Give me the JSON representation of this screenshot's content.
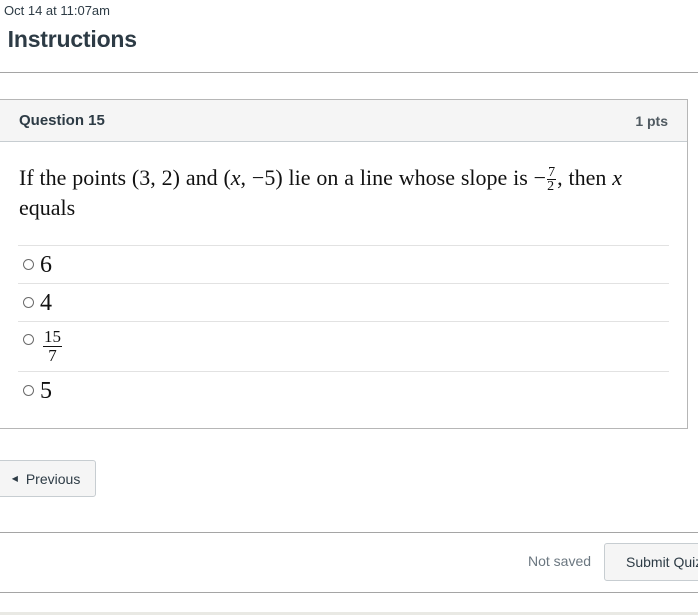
{
  "header": {
    "timestamp": "Oct 14 at 11:07am",
    "title": ": Instructions"
  },
  "question": {
    "name": "Question 15",
    "points": "1 pts",
    "text_part1": "If the points (3, 2) and (",
    "var_x": "x",
    "text_part2": ", −5) lie on a line whose slope is −",
    "slope_numerator": "7",
    "slope_denominator": "2",
    "text_part3": ", then ",
    "text_part4": " equals",
    "answers": [
      {
        "label": "6",
        "selected": false
      },
      {
        "label": "4",
        "selected": false
      },
      {
        "numerator": "15",
        "denominator": "7",
        "selected": false
      },
      {
        "label": "5",
        "selected": false
      }
    ]
  },
  "navigation": {
    "previous_label": "Previous",
    "previous_icon": "caret-left-icon"
  },
  "footer": {
    "save_status": "Not saved",
    "submit_label": "Submit Quiz"
  }
}
